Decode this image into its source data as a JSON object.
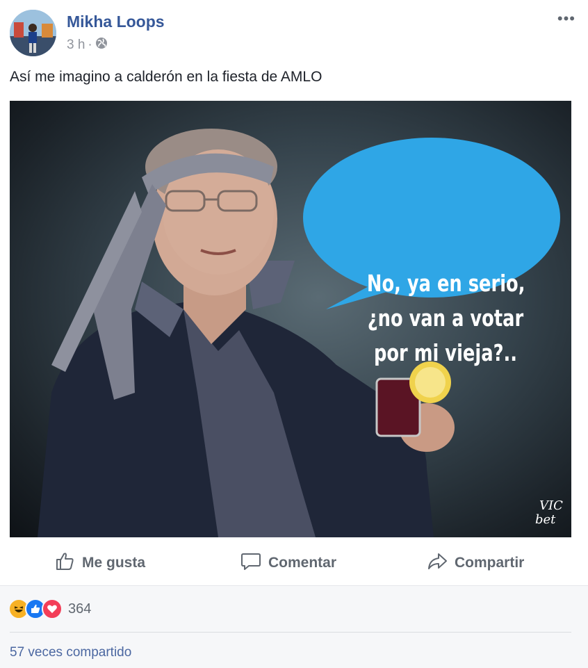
{
  "author": {
    "name": "Mikha Loops"
  },
  "meta": {
    "time": "3 h",
    "separator": "·",
    "privacy_icon": "globe-icon"
  },
  "menu": {
    "icon": "more-options-icon",
    "label": "•••"
  },
  "post": {
    "caption": "Así me imagino a calderón en la fiesta de AMLO"
  },
  "image": {
    "speech_bubble_lines": [
      "No, ya en serio,",
      "¿no van a votar",
      "por mi vieja?.."
    ],
    "signature": "VIC bet"
  },
  "actions": {
    "like": {
      "label": "Me gusta",
      "icon": "thumbs-up-icon"
    },
    "comment": {
      "label": "Comentar",
      "icon": "comment-bubble-icon"
    },
    "share": {
      "label": "Compartir",
      "icon": "share-arrow-icon"
    }
  },
  "reactions": {
    "types": [
      "haha",
      "like",
      "love"
    ],
    "count": "364"
  },
  "shares": {
    "text": "57 veces compartido"
  },
  "colors": {
    "author_link": "#365899",
    "meta_gray": "#90949c",
    "action_gray": "#606770",
    "like_blue": "#1877f2",
    "love_red": "#f33e58",
    "haha_yellow": "#f7b125",
    "bubble_blue": "#2fa6e6"
  }
}
